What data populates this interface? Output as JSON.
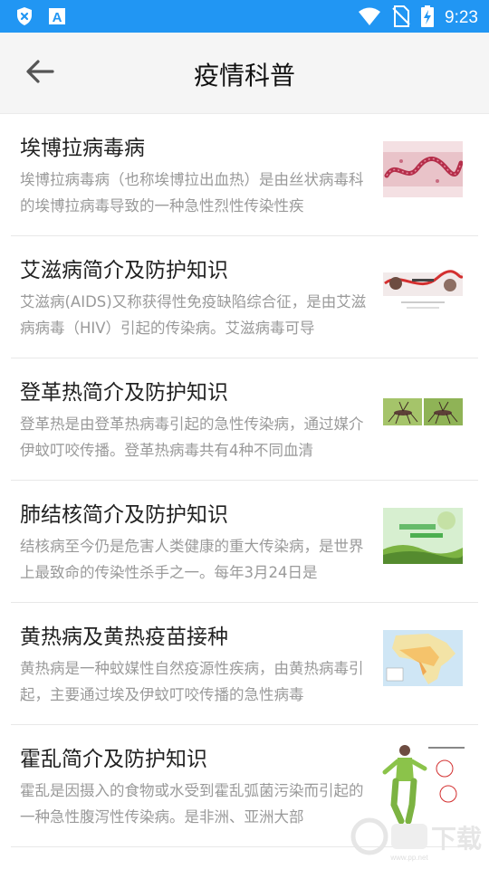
{
  "status_bar": {
    "time": "9:23",
    "left_icons": [
      "shield-x-icon",
      "app-a-icon"
    ],
    "right_icons": [
      "wifi-icon",
      "no-sim-icon",
      "battery-charging-icon"
    ]
  },
  "app_bar": {
    "title": "疫情科普",
    "back_icon": "arrow-left-icon"
  },
  "articles": [
    {
      "title": "埃博拉病毒病",
      "description": "埃博拉病毒病（也称埃博拉出血热）是由丝状病毒科的埃博拉病毒导致的一种急性烈性传染性疾",
      "thumbnail": "ebola-virus-image"
    },
    {
      "title": "艾滋病简介及防护知识",
      "description": "艾滋病(AIDS)又称获得性免疫缺陷综合征，是由艾滋病病毒（HIV）引起的传染病。艾滋病毒可导",
      "thumbnail": "aids-ribbon-image"
    },
    {
      "title": "登革热简介及防护知识",
      "description": "登革热是由登革热病毒引起的急性传染病，通过媒介伊蚊叮咬传播。登革热病毒共有4种不同血清",
      "thumbnail": "mosquito-image"
    },
    {
      "title": "肺结核简介及防护知识",
      "description": "结核病至今仍是危害人类健康的重大传染病，是世界上最致命的传染性杀手之一。每年3月24日是",
      "thumbnail": "tuberculosis-poster-image"
    },
    {
      "title": "黄热病及黄热疫苗接种",
      "description": "黄热病是一种蚊媒性自然疫源性疾病，由黄热病毒引起，主要通过埃及伊蚊叮咬传播的急性病毒",
      "thumbnail": "africa-map-image"
    },
    {
      "title": "霍乱简介及防护知识",
      "description": "霍乱是因摄入的食物或水受到霍乱弧菌污染而引起的一种急性腹泻性传染病。是非洲、亚洲大部",
      "thumbnail": "cholera-illustration-image"
    }
  ],
  "partial_item": {
    "title": ""
  },
  "watermark": {
    "text": "下载",
    "site": "www.pp.net"
  },
  "colors": {
    "status_bar": "#2196f3",
    "app_bar": "#f5f5f5",
    "title_text": "#222222",
    "desc_text": "#9a9a9a",
    "divider": "#e8e8e8"
  }
}
